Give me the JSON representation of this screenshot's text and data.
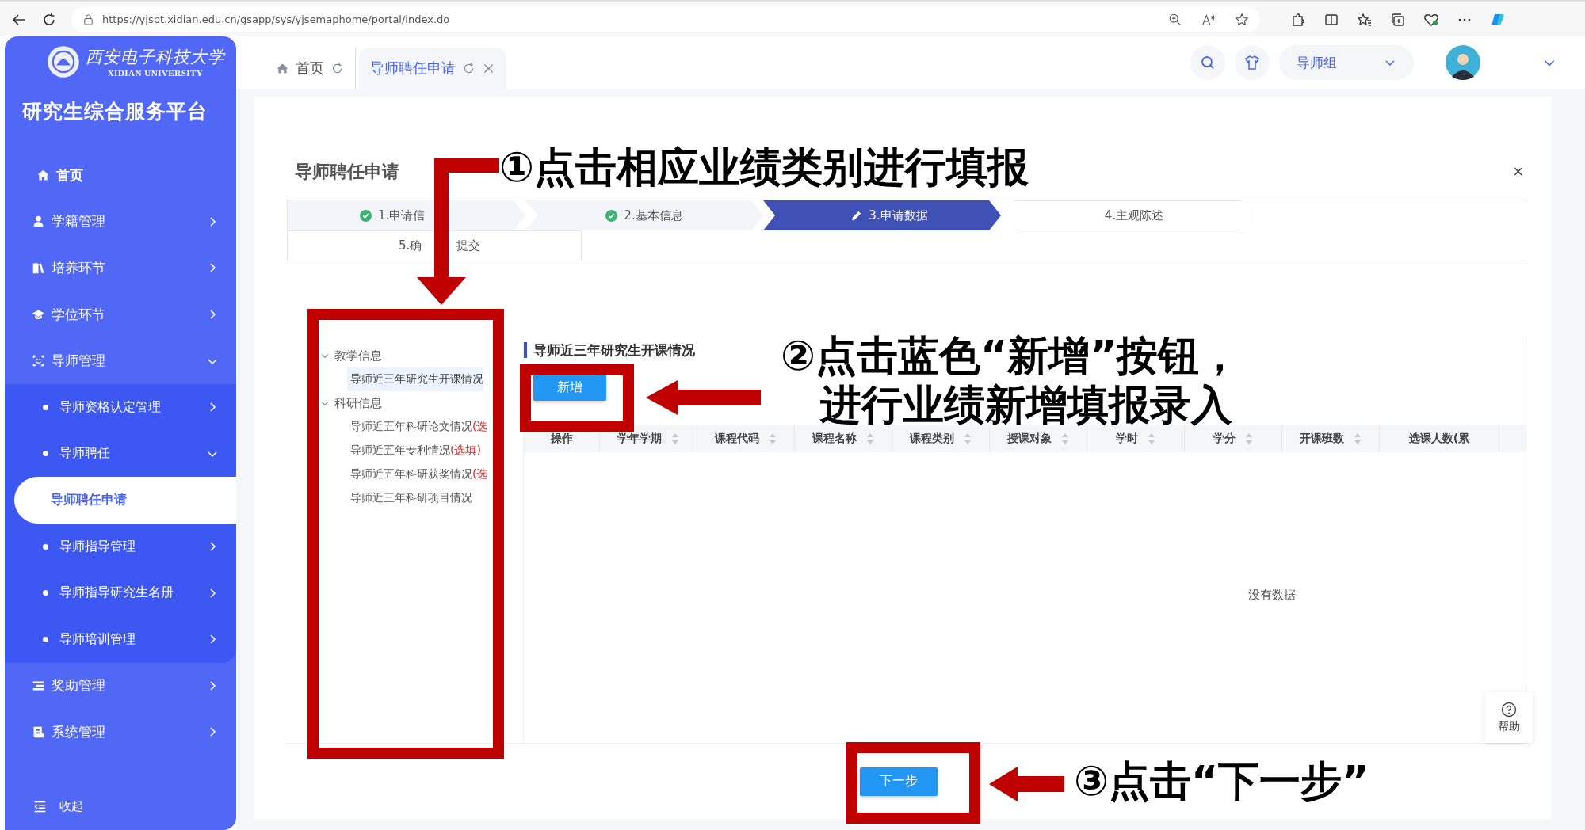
{
  "browser": {
    "url": "https://yjspt.xidian.edu.cn/gsapp/sys/yjsemaphome/portal/index.do"
  },
  "sidebar": {
    "logo": {
      "name_cn": "西安电子科技大学",
      "name_en": "XIDIAN UNIVERSITY"
    },
    "title": "研究生综合服务平台",
    "menu": [
      {
        "label": "首页",
        "selected": false
      },
      {
        "label": "学籍管理",
        "expanded": false,
        "selected": false
      },
      {
        "label": "培养环节",
        "expanded": false,
        "selected": false
      },
      {
        "label": "学位环节",
        "expanded": false,
        "selected": false
      },
      {
        "label": "导师管理",
        "expanded": true,
        "selected": false,
        "children": [
          {
            "label": "导师资格认定管理",
            "expanded": false,
            "selected": false
          },
          {
            "label": "导师聘任",
            "expanded": true,
            "selected": false,
            "children": [
              {
                "label": "导师聘任申请",
                "selected": true
              }
            ]
          },
          {
            "label": "导师指导管理",
            "expanded": false,
            "selected": false
          },
          {
            "label": "导师指导研究生名册",
            "expanded": false,
            "selected": false
          },
          {
            "label": "导师培训管理",
            "expanded": false,
            "selected": false
          }
        ]
      },
      {
        "label": "奖助管理",
        "expanded": false,
        "selected": false
      },
      {
        "label": "系统管理",
        "expanded": false,
        "selected": false
      }
    ],
    "collapse": "收起"
  },
  "header": {
    "tabs": [
      {
        "label": "首页",
        "selected": false,
        "closable": false
      },
      {
        "label": "导师聘任申请",
        "selected": true,
        "closable": true
      }
    ],
    "role": "导师组"
  },
  "form": {
    "title": "导师聘任申请",
    "close": "×",
    "steps": [
      {
        "label": "1.申请信",
        "completed": true,
        "selected": false
      },
      {
        "label": "2.基本信息",
        "completed": true,
        "selected": false
      },
      {
        "label": "3.申请数据",
        "completed": false,
        "selected": true
      },
      {
        "label": "4.主观陈述",
        "completed": false,
        "selected": false
      },
      {
        "label": "5.确",
        "label_tail": "提交",
        "completed": false,
        "selected": false
      }
    ],
    "tree": [
      {
        "label": "教学信息",
        "expanded": true,
        "children": [
          {
            "label": "导师近三年研究生开课情况",
            "selected": true
          }
        ]
      },
      {
        "label": "科研信息",
        "expanded": true,
        "children": [
          {
            "label": "导师近五年科研论文情况",
            "note": "(选",
            "selected": false
          },
          {
            "label": "导师近五年专利情况",
            "note": "(选填)",
            "selected": false
          },
          {
            "label": "导师近五年科研获奖情况",
            "note": "(选",
            "selected": false
          },
          {
            "label": "导师近三年科研项目情况",
            "selected": false
          }
        ]
      }
    ],
    "section_title": "导师近三年研究生开课情况",
    "add_button": "新增",
    "table": {
      "columns": [
        {
          "label": "操作",
          "sortable": false
        },
        {
          "label": "学年学期",
          "sortable": true
        },
        {
          "label": "课程代码",
          "sortable": true
        },
        {
          "label": "课程名称",
          "sortable": true
        },
        {
          "label": "课程类别",
          "sortable": true
        },
        {
          "label": "授课对象",
          "sortable": true
        },
        {
          "label": "学时",
          "sortable": true
        },
        {
          "label": "学分",
          "sortable": true
        },
        {
          "label": "开课班数",
          "sortable": true
        },
        {
          "label": "选课人数(累",
          "sortable": false
        }
      ],
      "empty_text": "没有数据"
    },
    "help": "帮助",
    "next_button": "下一步"
  },
  "annotations": [
    {
      "marker": "①",
      "lines": [
        "点击相应业绩类别进行填报"
      ]
    },
    {
      "marker": "②",
      "lines": [
        "点击蓝色“新增”按钮，",
        "进行业绩新增填报录入"
      ]
    },
    {
      "marker": "③",
      "lines": [
        "点击“下一步”"
      ]
    }
  ]
}
